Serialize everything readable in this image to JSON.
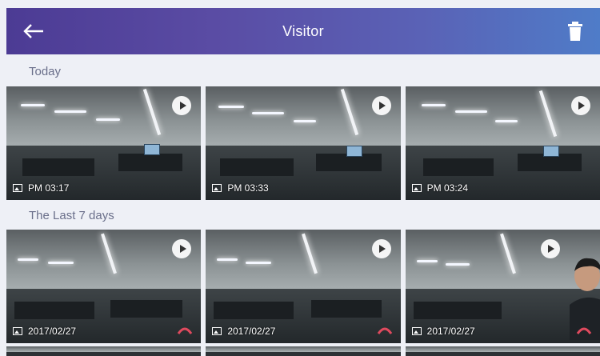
{
  "header": {
    "title": "Visitor",
    "back_icon": "arrow-left-icon",
    "delete_icon": "trash-icon",
    "gradient": [
      "#4c3b94",
      "#4f7cc8"
    ]
  },
  "sections": [
    {
      "label": "Today",
      "items": [
        {
          "caption": "PM 03:17",
          "type": "image"
        },
        {
          "caption": "PM 03:33",
          "type": "image"
        },
        {
          "caption": "PM 03:24",
          "type": "image"
        }
      ]
    },
    {
      "label": "The Last 7 days",
      "items": [
        {
          "caption": "2017/02/27",
          "type": "video"
        },
        {
          "caption": "2017/02/27",
          "type": "video"
        },
        {
          "caption": "2017/02/27",
          "type": "video"
        }
      ]
    }
  ],
  "colors": {
    "motion_alert": "#e04a5e",
    "section_text": "#6a6f8a"
  }
}
